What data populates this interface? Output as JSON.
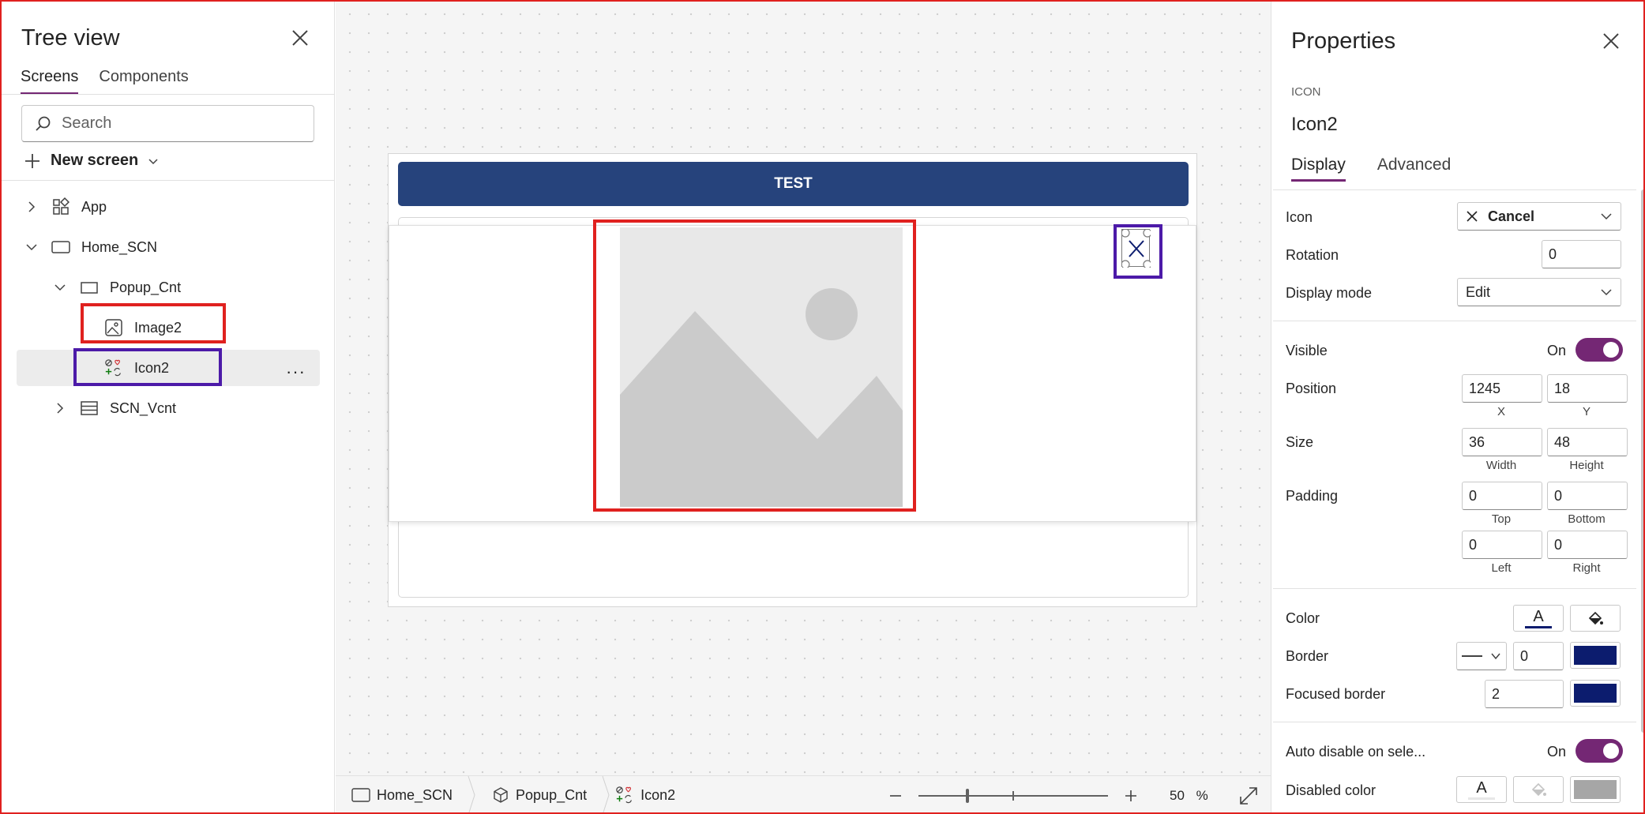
{
  "tree": {
    "title": "Tree view",
    "tabs": [
      "Screens",
      "Components"
    ],
    "search_placeholder": "Search",
    "new_screen": "New screen",
    "nodes": {
      "app": "App",
      "home": "Home_SCN",
      "popup": "Popup_Cnt",
      "image2": "Image2",
      "icon2": "Icon2",
      "scn_vcnt": "SCN_Vcnt"
    },
    "more": "···"
  },
  "canvas": {
    "header_text": "TEST"
  },
  "statusbar": {
    "crumbs": [
      "Home_SCN",
      "Popup_Cnt",
      "Icon2"
    ],
    "zoom_value": "50",
    "zoom_unit": "%",
    "zoom_fraction": 0.25
  },
  "properties": {
    "title": "Properties",
    "control_type": "ICON",
    "control_name": "Icon2",
    "tabs": [
      "Display",
      "Advanced"
    ],
    "icon_label": "Icon",
    "icon_value": "Cancel",
    "rotation_label": "Rotation",
    "rotation_value": "0",
    "display_mode_label": "Display mode",
    "display_mode_value": "Edit",
    "visible_label": "Visible",
    "visible_state": "On",
    "position_label": "Position",
    "position_x": "1245",
    "position_y": "18",
    "x_label": "X",
    "y_label": "Y",
    "size_label": "Size",
    "size_width": "36",
    "size_height": "48",
    "width_label": "Width",
    "height_label": "Height",
    "padding_label": "Padding",
    "padding_top": "0",
    "padding_bottom": "0",
    "padding_left": "0",
    "padding_right": "0",
    "top_label": "Top",
    "bottom_label": "Bottom",
    "left_label": "Left",
    "right_label": "Right",
    "color_label": "Color",
    "color_glyph": "A",
    "border_label": "Border",
    "border_value": "0",
    "focused_border_label": "Focused border",
    "focused_border_value": "2",
    "auto_disable_label": "Auto disable on sele...",
    "auto_disable_state": "On",
    "disabled_color_label": "Disabled color",
    "disabled_glyph": "A",
    "accent_color": "#742774",
    "border_color": "#0c1c6e"
  }
}
